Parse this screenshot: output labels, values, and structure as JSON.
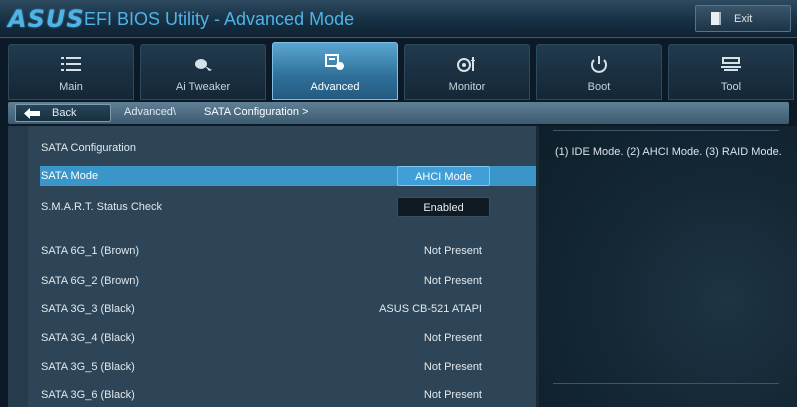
{
  "header": {
    "logo_text": "ASUS",
    "title": "EFI BIOS Utility - Advanced Mode",
    "exit_label": "Exit",
    "accent_color": "#4fb3e6"
  },
  "tabs": [
    {
      "label": "Main",
      "icon": "list-icon",
      "active": false
    },
    {
      "label": "Ai  Tweaker",
      "icon": "tweaker-icon",
      "active": false
    },
    {
      "label": "Advanced",
      "icon": "advanced-chip-icon",
      "active": true
    },
    {
      "label": "Monitor",
      "icon": "monitor-fan-icon",
      "active": false
    },
    {
      "label": "Boot",
      "icon": "power-icon",
      "active": false
    },
    {
      "label": "Tool",
      "icon": "tool-icon",
      "active": false
    }
  ],
  "breadcrumb": {
    "back_label": "Back",
    "parent": "Advanced\\",
    "current": "SATA Configuration  >"
  },
  "main": {
    "section_title": "SATA Configuration",
    "sata_mode": {
      "label": "SATA Mode",
      "value": "AHCI Mode"
    },
    "smart": {
      "label": "S.M.A.R.T. Status Check",
      "value": "Enabled"
    },
    "ports": [
      {
        "label": "SATA 6G_1 (Brown)",
        "value": "Not Present"
      },
      {
        "label": "SATA 6G_2 (Brown)",
        "value": "Not Present"
      },
      {
        "label": "SATA 3G_3 (Black)",
        "value": "ASUS   CB-521 ATAPI"
      },
      {
        "label": "SATA 3G_4 (Black)",
        "value": "Not Present"
      },
      {
        "label": "SATA 3G_5 (Black)",
        "value": "Not Present"
      },
      {
        "label": "SATA 3G_6 (Black)",
        "value": "Not Present"
      }
    ]
  },
  "help": {
    "text": "(1) IDE Mode. (2) AHCI Mode. (3) RAID Mode."
  }
}
